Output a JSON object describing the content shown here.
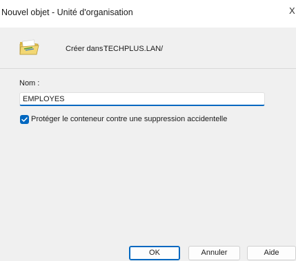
{
  "window": {
    "title": "Nouvel objet - Unité d'organisation",
    "close_glyph": "X"
  },
  "header": {
    "icon": "folder-icon",
    "create_label": "Créer dans :",
    "create_path": "TECHPLUS.LAN/"
  },
  "form": {
    "name_label": "Nom :",
    "name_value": "EMPLOYES",
    "protect_checkbox": {
      "label": "Protéger le conteneur contre une suppression accidentelle",
      "checked": true
    }
  },
  "buttons": {
    "ok": "OK",
    "cancel": "Annuler",
    "help": "Aide"
  },
  "colors": {
    "accent": "#0067c0",
    "background": "#f0f0f0",
    "titlebar": "#ffffff"
  }
}
